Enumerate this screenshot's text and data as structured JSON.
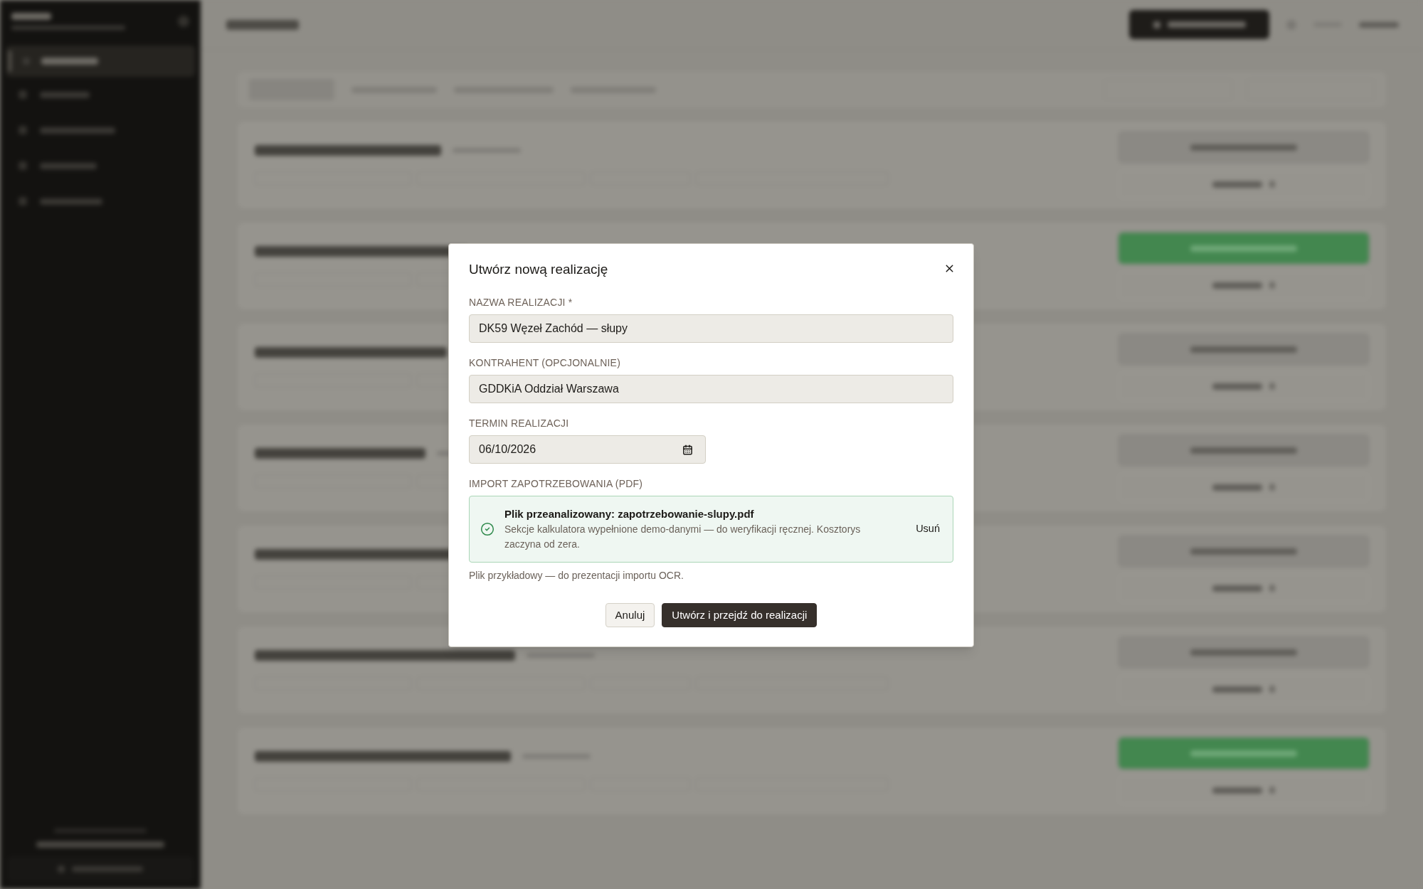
{
  "dialog": {
    "title": "Utwórz nową realizację",
    "fields": [
      {
        "kind": "text",
        "label": "NAZWA REALIZACJI *",
        "value": "DK59 Węzeł Zachód — słupy"
      },
      {
        "kind": "text",
        "label": "KONTRAHENT (OPCJONALNIE)",
        "value": "GDDKiA Oddział Warszawa"
      },
      {
        "kind": "date",
        "label": "TERMIN REALIZACJI",
        "value": "06/10/2026"
      }
    ],
    "import": {
      "label": "IMPORT ZAPOTRZEBOWANIA (PDF)",
      "status": {
        "title": "Plik przeanalizowany: zapotrzebowanie-slupy.pdf",
        "description": "Sekcje kalkulatora wypełnione demo-danymi — do weryfikacji ręcznej. Kosztorys zaczyna od zera.",
        "action": "Usuń"
      },
      "note": "Plik przykładowy — do prezentacji importu OCR."
    },
    "buttons": [
      {
        "kind": "secondary",
        "label": "Anuluj"
      },
      {
        "kind": "primary",
        "label": "Utwórz i przejdź do realizacji"
      }
    ]
  }
}
